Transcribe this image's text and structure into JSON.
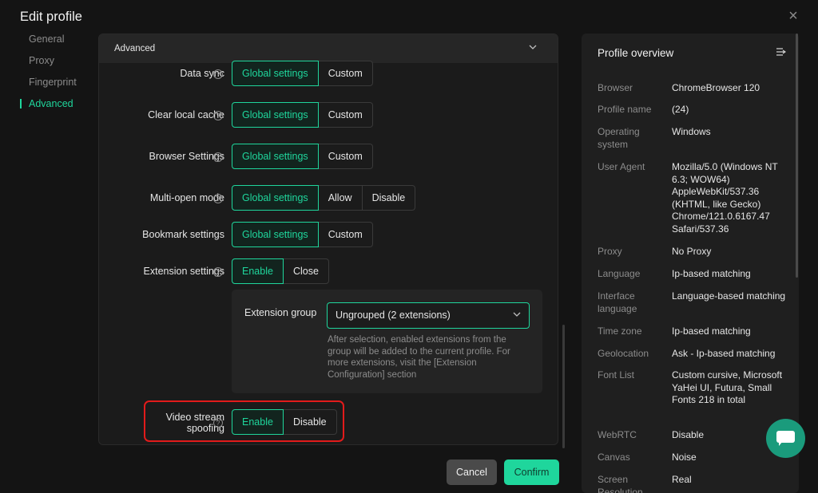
{
  "dialog": {
    "title": "Edit profile",
    "close_icon": "close-icon"
  },
  "nav": {
    "items": [
      "General",
      "Proxy",
      "Fingerprint",
      "Advanced"
    ],
    "active": "Advanced"
  },
  "panel": {
    "header": "Advanced",
    "help_glyph": "?",
    "rows": [
      {
        "label": "Data sync",
        "options": [
          "Global settings",
          "Custom"
        ],
        "selected": "Global settings"
      },
      {
        "label": "Clear local cache",
        "options": [
          "Global settings",
          "Custom"
        ],
        "selected": "Global settings"
      },
      {
        "label": "Browser Settings",
        "options": [
          "Global settings",
          "Custom"
        ],
        "selected": "Global settings"
      },
      {
        "label": "Multi-open mode",
        "options": [
          "Global settings",
          "Allow",
          "Disable"
        ],
        "selected": "Global settings"
      },
      {
        "label": "Bookmark settings",
        "options": [
          "Global settings",
          "Custom"
        ],
        "selected": "Global settings"
      },
      {
        "label": "Extension settings",
        "options": [
          "Enable",
          "Close"
        ],
        "selected": "Enable"
      }
    ],
    "extension_group": {
      "label": "Extension group",
      "value": "Ungrouped (2 extensions)",
      "note": "After selection, enabled extensions from the group will be added to the current profile. For more extensions, visit the [Extension Configuration] section"
    },
    "video_stream": {
      "label_line1": "Video stream",
      "label_line2": "spoofing",
      "options": [
        "Enable",
        "Disable"
      ],
      "selected": "Enable"
    }
  },
  "actions": {
    "cancel": "Cancel",
    "confirm": "Confirm"
  },
  "overview": {
    "title": "Profile overview",
    "rows": [
      {
        "key": "Browser",
        "value": "ChromeBrowser 120"
      },
      {
        "key": "Profile name",
        "value": "(24)"
      },
      {
        "key": "Operating system",
        "value": "Windows"
      },
      {
        "key": "User Agent",
        "value": "Mozilla/5.0 (Windows NT 6.3; WOW64) AppleWebKit/537.36 (KHTML, like Gecko) Chrome/121.0.6167.47 Safari/537.36"
      },
      {
        "key": "Proxy",
        "value": "No Proxy"
      },
      {
        "key": "Language",
        "value": "Ip-based matching"
      },
      {
        "key": "Interface language",
        "value": "Language-based matching"
      },
      {
        "key": "Time zone",
        "value": "Ip-based matching"
      },
      {
        "key": "Geolocation",
        "value": "Ask - Ip-based matching"
      },
      {
        "key": "Font List",
        "value": "Custom cursive, Microsoft YaHei UI, Futura, Small Fonts 218 in total"
      },
      {
        "key": "WebRTC",
        "value": "Disable"
      },
      {
        "key": "Canvas",
        "value": "Noise"
      },
      {
        "key": "Screen Resolution",
        "value": "Real"
      }
    ]
  },
  "colors": {
    "accent": "#1fd69c",
    "highlight": "#e21b1b",
    "fab": "#1a9b7c"
  }
}
